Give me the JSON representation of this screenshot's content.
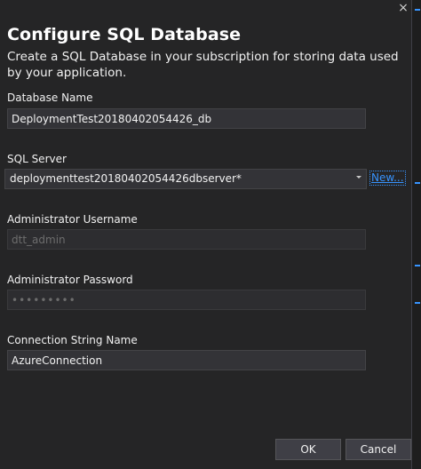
{
  "dialog": {
    "title": "Configure SQL Database",
    "subtitle": "Create a SQL Database in your subscription for storing data used by your application.",
    "close_glyph": "×"
  },
  "fields": {
    "database_name": {
      "label": "Database Name",
      "value": "DeploymentTest20180402054426_db"
    },
    "sql_server": {
      "label": "SQL Server",
      "value": "deploymenttest20180402054426dbserver*",
      "new_link": "New..."
    },
    "admin_username": {
      "label": "Administrator Username",
      "value": "dtt_admin"
    },
    "admin_password": {
      "label": "Administrator Password",
      "value": "•••••••••"
    },
    "connection_string": {
      "label": "Connection String Name",
      "value": "AzureConnection"
    }
  },
  "buttons": {
    "ok": "OK",
    "cancel": "Cancel"
  },
  "colors": {
    "background": "#252526",
    "accent": "#3794ff",
    "input_bg": "#333337"
  }
}
